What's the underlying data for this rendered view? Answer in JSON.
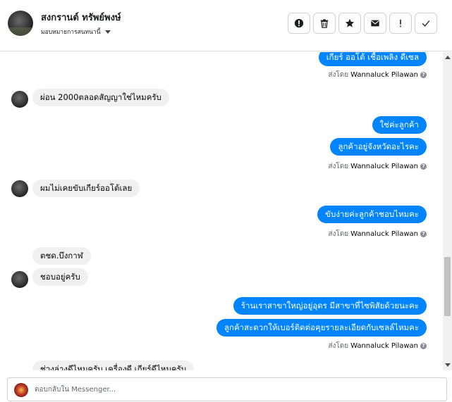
{
  "header": {
    "contact_name": "สงกรานต์ ทรัพย์พงษ์",
    "assign_label": "มอบหมายการสนทนานี้",
    "actions": [
      "alert-circle-icon",
      "trash-icon",
      "star-icon",
      "envelope-icon",
      "exclamation-icon",
      "check-icon"
    ]
  },
  "thread": {
    "sent_by_prefix": "ส่งโดย",
    "sender": "Wannaluck Pilawan",
    "messages": [
      {
        "dir": "out",
        "text": "เกียร์ ออโต้ เชื้อเพลิง ดีเซล"
      },
      {
        "dir": "in",
        "text": "ผ่อน 2000ตลอดสัญญาใช่ไหมครับ"
      },
      {
        "dir": "out",
        "text": "ใช่ค่ะลูกค้า"
      },
      {
        "dir": "out",
        "text": "ลูกค้าอยู่จังหวัดอะไรคะ"
      },
      {
        "dir": "in",
        "text": "ผมไม่เคยขับเกียร์ออโต้เลย"
      },
      {
        "dir": "out",
        "text": "ขับง่ายค่ะลูกค้าชอบไหมคะ"
      },
      {
        "dir": "in",
        "text": "ตชด.บึงกาฬ"
      },
      {
        "dir": "in",
        "text": "ชอบอยู่ครับ"
      },
      {
        "dir": "out",
        "text": "ร้านเราสาขาใหญ่อยู่อุดร   มีสาขาที่ไซพิสัยด้วยนะคะ"
      },
      {
        "dir": "out",
        "text": "ลูกค้าสะดวกให้เบอร์ติดต่อคุยรายละเอียดกับเซลล์ไหมคะ"
      },
      {
        "dir": "in",
        "text": "ช่วงล่างดีไหมครับ เครื่องดี เกียร์ดีไหมครับ"
      }
    ]
  },
  "composer": {
    "placeholder": "ตอบกลับใน Messenger..."
  }
}
